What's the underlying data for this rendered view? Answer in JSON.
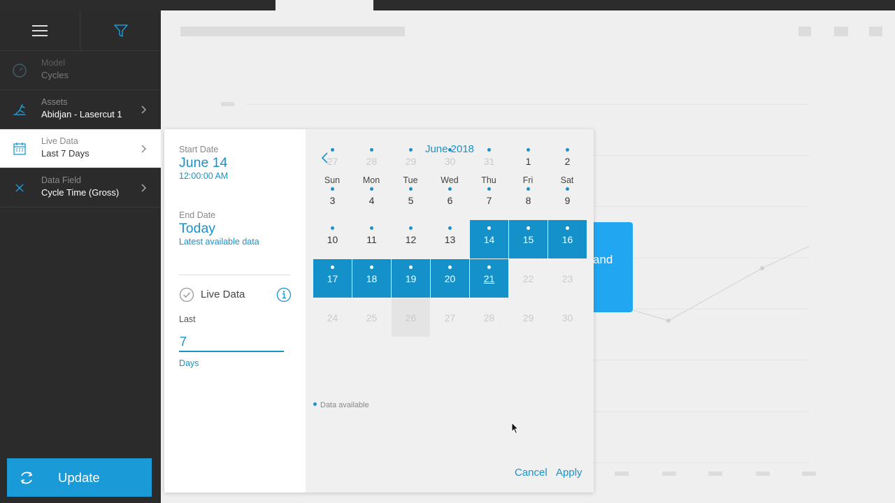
{
  "sidebar": {
    "items": [
      {
        "label": "Model",
        "value": "Cycles"
      },
      {
        "label": "Assets",
        "value": "Abidjan - Lasercut 1"
      },
      {
        "label": "Live Data",
        "value": "Last 7 Days"
      },
      {
        "label": "Data Field",
        "value": "Cycle Time (Gross)"
      }
    ],
    "update_label": "Update"
  },
  "background": {
    "card_text": "and"
  },
  "dialog": {
    "start_label": "Start Date",
    "start_date": "June 14",
    "start_time": "12:00:00 AM",
    "end_label": "End Date",
    "end_date": "Today",
    "end_sub": "Latest available data",
    "live_label": "Live Data",
    "last_label": "Last",
    "last_value": "7",
    "days_label": "Days",
    "cancel_label": "Cancel",
    "apply_label": "Apply"
  },
  "calendar": {
    "title": "June 2018",
    "weekdays": [
      "Sun",
      "Mon",
      "Tue",
      "Wed",
      "Thu",
      "Fri",
      "Sat"
    ],
    "days": [
      {
        "n": "27",
        "muted": true,
        "dot": true,
        "sel": false
      },
      {
        "n": "28",
        "muted": true,
        "dot": true,
        "sel": false
      },
      {
        "n": "29",
        "muted": true,
        "dot": true,
        "sel": false
      },
      {
        "n": "30",
        "muted": true,
        "dot": true,
        "sel": false
      },
      {
        "n": "31",
        "muted": true,
        "dot": true,
        "sel": false
      },
      {
        "n": "1",
        "muted": false,
        "dot": true,
        "sel": false
      },
      {
        "n": "2",
        "muted": false,
        "dot": true,
        "sel": false
      },
      {
        "n": "3",
        "muted": false,
        "dot": true,
        "sel": false
      },
      {
        "n": "4",
        "muted": false,
        "dot": true,
        "sel": false
      },
      {
        "n": "5",
        "muted": false,
        "dot": true,
        "sel": false
      },
      {
        "n": "6",
        "muted": false,
        "dot": true,
        "sel": false
      },
      {
        "n": "7",
        "muted": false,
        "dot": true,
        "sel": false
      },
      {
        "n": "8",
        "muted": false,
        "dot": true,
        "sel": false
      },
      {
        "n": "9",
        "muted": false,
        "dot": true,
        "sel": false
      },
      {
        "n": "10",
        "muted": false,
        "dot": true,
        "sel": false
      },
      {
        "n": "11",
        "muted": false,
        "dot": true,
        "sel": false
      },
      {
        "n": "12",
        "muted": false,
        "dot": true,
        "sel": false
      },
      {
        "n": "13",
        "muted": false,
        "dot": true,
        "sel": false
      },
      {
        "n": "14",
        "muted": false,
        "dot": true,
        "sel": true
      },
      {
        "n": "15",
        "muted": false,
        "dot": true,
        "sel": true
      },
      {
        "n": "16",
        "muted": false,
        "dot": true,
        "sel": true
      },
      {
        "n": "17",
        "muted": false,
        "dot": true,
        "sel": true
      },
      {
        "n": "18",
        "muted": false,
        "dot": true,
        "sel": true
      },
      {
        "n": "19",
        "muted": false,
        "dot": true,
        "sel": true
      },
      {
        "n": "20",
        "muted": false,
        "dot": true,
        "sel": true
      },
      {
        "n": "21",
        "muted": false,
        "dot": true,
        "sel": true,
        "today": true
      },
      {
        "n": "22",
        "muted": true,
        "dot": false,
        "sel": false
      },
      {
        "n": "23",
        "muted": true,
        "dot": false,
        "sel": false
      },
      {
        "n": "24",
        "muted": true,
        "dot": false,
        "sel": false
      },
      {
        "n": "25",
        "muted": true,
        "dot": false,
        "sel": false
      },
      {
        "n": "26",
        "muted": true,
        "dot": false,
        "sel": false,
        "hover": true
      },
      {
        "n": "27",
        "muted": true,
        "dot": false,
        "sel": false
      },
      {
        "n": "28",
        "muted": true,
        "dot": false,
        "sel": false
      },
      {
        "n": "29",
        "muted": true,
        "dot": false,
        "sel": false
      },
      {
        "n": "30",
        "muted": true,
        "dot": false,
        "sel": false
      }
    ],
    "legend": "Data available"
  },
  "colors": {
    "accent": "#1a91c8",
    "selected": "#1591c9",
    "update_button": "#1a9bd7",
    "sidebar_bg": "#2b2b2b",
    "card_blue": "#21a7f2"
  }
}
